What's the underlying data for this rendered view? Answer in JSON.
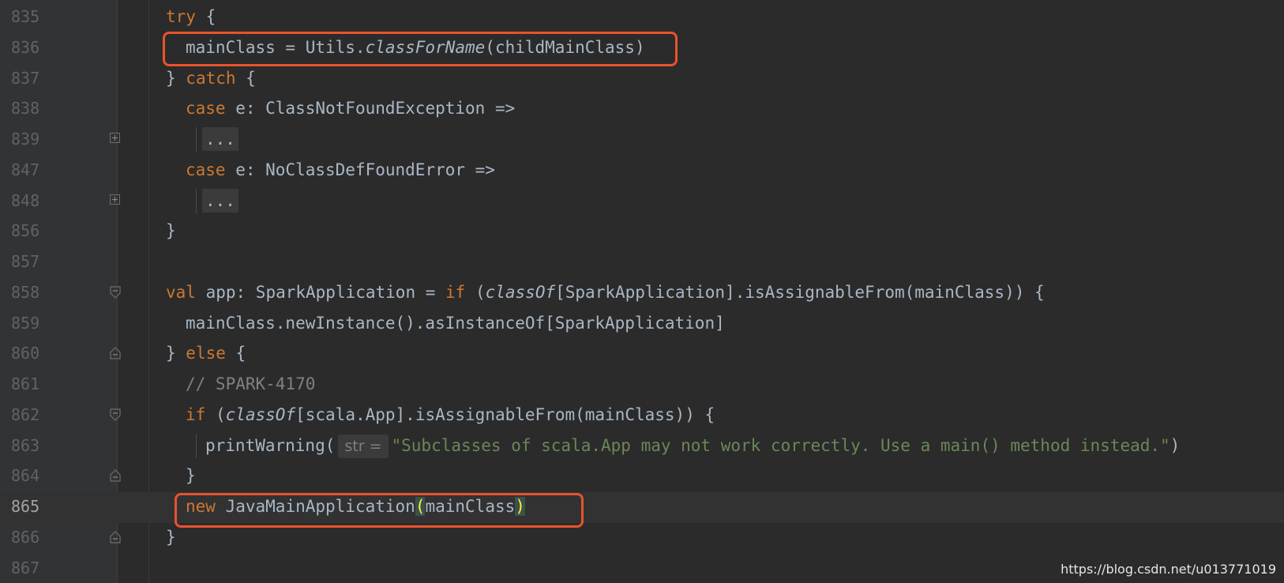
{
  "lines": [
    {
      "num": "835",
      "tokens": [
        {
          "t": "try",
          "c": "kw"
        },
        {
          "t": " {",
          "c": ""
        }
      ]
    },
    {
      "num": "836",
      "tokens": [
        {
          "t": "mainClass = Utils.",
          "c": ""
        },
        {
          "t": "classForName",
          "c": "fn"
        },
        {
          "t": "(childMainClass)",
          "c": ""
        }
      ]
    },
    {
      "num": "837",
      "tokens": [
        {
          "t": "} ",
          "c": ""
        },
        {
          "t": "catch",
          "c": "kw"
        },
        {
          "t": " {",
          "c": ""
        }
      ]
    },
    {
      "num": "838",
      "tokens": [
        {
          "t": "case",
          "c": "kw"
        },
        {
          "t": " e: ClassNotFoundException =>",
          "c": ""
        }
      ]
    },
    {
      "num": "839",
      "collapsed": "..."
    },
    {
      "num": "847",
      "tokens": [
        {
          "t": "case",
          "c": "kw"
        },
        {
          "t": " e: NoClassDefFoundError =>",
          "c": ""
        }
      ]
    },
    {
      "num": "848",
      "collapsed": "..."
    },
    {
      "num": "856",
      "tokens": [
        {
          "t": "}",
          "c": ""
        }
      ]
    },
    {
      "num": "857",
      "tokens": []
    },
    {
      "num": "858",
      "tokens": [
        {
          "t": "val",
          "c": "kw"
        },
        {
          "t": " app: SparkApplication = ",
          "c": ""
        },
        {
          "t": "if",
          "c": "kw"
        },
        {
          "t": " (",
          "c": ""
        },
        {
          "t": "classOf",
          "c": "fn"
        },
        {
          "t": "[SparkApplication].isAssignableFrom(mainClass)) {",
          "c": ""
        }
      ]
    },
    {
      "num": "859",
      "tokens": [
        {
          "t": "mainClass.newInstance().asInstanceOf[SparkApplication]",
          "c": ""
        }
      ]
    },
    {
      "num": "860",
      "tokens": [
        {
          "t": "} ",
          "c": ""
        },
        {
          "t": "else",
          "c": "kw"
        },
        {
          "t": " {",
          "c": ""
        }
      ]
    },
    {
      "num": "861",
      "tokens": [
        {
          "t": "// SPARK-4170",
          "c": "cm"
        }
      ]
    },
    {
      "num": "862",
      "tokens": [
        {
          "t": "if",
          "c": "kw"
        },
        {
          "t": " (",
          "c": ""
        },
        {
          "t": "classOf",
          "c": "fn"
        },
        {
          "t": "[scala.App].isAssignableFrom(mainClass)) {",
          "c": ""
        }
      ]
    },
    {
      "num": "863",
      "tokens": [
        {
          "t": "printWarning(",
          "c": ""
        }
      ],
      "hint": "str =",
      "after": [
        {
          "t": "\"Subclasses of scala.App may not work correctly. Use a main() method instead.\"",
          "c": "st"
        },
        {
          "t": ")",
          "c": ""
        }
      ]
    },
    {
      "num": "864",
      "tokens": [
        {
          "t": "}",
          "c": ""
        }
      ]
    },
    {
      "num": "865",
      "tokens": [
        {
          "t": "new",
          "c": "kw"
        },
        {
          "t": " JavaMainApplication",
          "c": ""
        },
        {
          "t": "(",
          "c": "pm"
        },
        {
          "t": "mainClass",
          "c": ""
        },
        {
          "t": ")",
          "c": "pm"
        }
      ]
    },
    {
      "num": "866",
      "tokens": [
        {
          "t": "}",
          "c": ""
        }
      ]
    },
    {
      "num": "867",
      "tokens": []
    }
  ],
  "current_line": "865",
  "watermark": "https://blog.csdn.net/u013771019",
  "colors": {
    "background": "#2b2b2b",
    "keyword": "#cc7832",
    "text": "#a9b7c6",
    "comment": "#808080",
    "string": "#6a8759",
    "highlight": "#e8532c"
  },
  "icons": {
    "fold_plus": "fold-expand-icon",
    "fold_start": "fold-start-icon",
    "fold_end": "fold-end-icon"
  }
}
